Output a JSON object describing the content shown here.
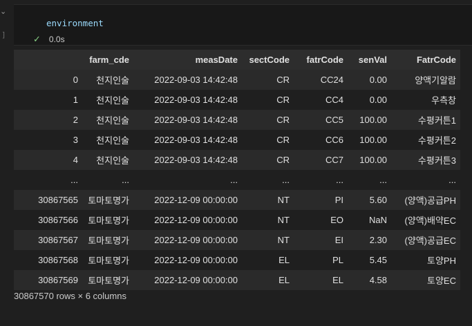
{
  "cell": {
    "code": "environment",
    "exec_time": "0.0s",
    "left_marker": "]"
  },
  "table": {
    "headers": [
      "",
      "farm_cde",
      "measDate",
      "sectCode",
      "fatrCode",
      "senVal",
      "FatrCode"
    ],
    "rows": [
      [
        "0",
        "천지인술",
        "2022-09-03 14:42:48",
        "CR",
        "CC24",
        "0.00",
        "양액기알람"
      ],
      [
        "1",
        "천지인술",
        "2022-09-03 14:42:48",
        "CR",
        "CC4",
        "0.00",
        "우측창"
      ],
      [
        "2",
        "천지인술",
        "2022-09-03 14:42:48",
        "CR",
        "CC5",
        "100.00",
        "수평커튼1"
      ],
      [
        "3",
        "천지인술",
        "2022-09-03 14:42:48",
        "CR",
        "CC6",
        "100.00",
        "수평커튼2"
      ],
      [
        "4",
        "천지인술",
        "2022-09-03 14:42:48",
        "CR",
        "CC7",
        "100.00",
        "수평커튼3"
      ],
      [
        "...",
        "...",
        "...",
        "...",
        "...",
        "...",
        "..."
      ],
      [
        "30867565",
        "토마토명가",
        "2022-12-09 00:00:00",
        "NT",
        "PI",
        "5.60",
        "(양액)공급PH"
      ],
      [
        "30867566",
        "토마토명가",
        "2022-12-09 00:00:00",
        "NT",
        "EO",
        "NaN",
        "(양액)배약EC"
      ],
      [
        "30867567",
        "토마토명가",
        "2022-12-09 00:00:00",
        "NT",
        "EI",
        "2.30",
        "(양액)공급EC"
      ],
      [
        "30867568",
        "토마토명가",
        "2022-12-09 00:00:00",
        "EL",
        "PL",
        "5.45",
        "토양PH"
      ],
      [
        "30867569",
        "토마토명가",
        "2022-12-09 00:00:00",
        "EL",
        "EL",
        "4.58",
        "토양EC"
      ]
    ]
  },
  "footer": "30867570 rows × 6 columns",
  "icons": {
    "collapse": "chevron-down-icon",
    "success": "check-icon"
  }
}
